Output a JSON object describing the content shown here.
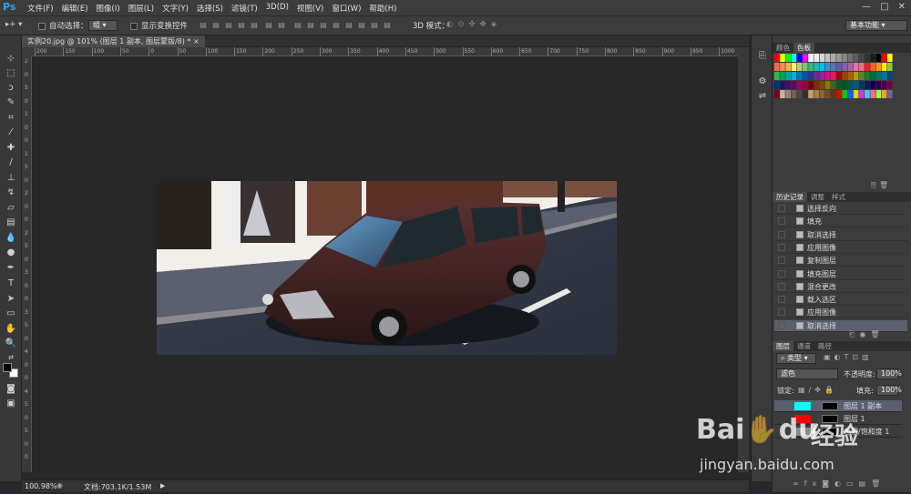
{
  "app": {
    "logo": "Ps",
    "menus": [
      "文件(F)",
      "编辑(E)",
      "图像(I)",
      "图层(L)",
      "文字(Y)",
      "选择(S)",
      "滤镜(T)",
      "3D(D)",
      "视图(V)",
      "窗口(W)",
      "帮助(H)"
    ],
    "window_controls": [
      "—",
      "□",
      "✕"
    ]
  },
  "options": {
    "auto_select_label": "自动选择：",
    "auto_select_value": "组",
    "show_transform_label": "显示变换控件",
    "mode3d_label": "3D 模式：",
    "workspace": "基本功能"
  },
  "document": {
    "tab_title": "实例20.jpg @ 101% (图层 1 副本, 图层蒙版/8) *",
    "close": "×"
  },
  "rulers": {
    "h": [
      "200",
      "150",
      "100",
      "50",
      "0",
      "50",
      "100",
      "150",
      "200",
      "250",
      "300",
      "350",
      "400",
      "450",
      "500",
      "550",
      "600",
      "650",
      "700",
      "750",
      "800",
      "850",
      "900",
      "950",
      "1000"
    ],
    "v": [
      "2",
      "0",
      "5",
      "0",
      "1",
      "0",
      "0",
      "1",
      "5",
      "0",
      "2",
      "0",
      "0",
      "2",
      "5",
      "0",
      "3",
      "0",
      "0",
      "3",
      "5",
      "0",
      "4",
      "0",
      "0",
      "4",
      "5",
      "0",
      "5",
      "0",
      "0"
    ]
  },
  "status": {
    "zoom": "100.98%",
    "doc": "文档:703.1K/1.53M"
  },
  "swatches": {
    "tabs": [
      "颜色",
      "色板"
    ],
    "active": 1
  },
  "history": {
    "tabs": [
      "历史记录",
      "调整",
      "样式"
    ],
    "items": [
      "选择反向",
      "填充",
      "取消选择",
      "应用图像",
      "复制图层",
      "填充图层",
      "混合更改",
      "载入选区",
      "应用图像",
      "取消选择"
    ]
  },
  "layers": {
    "tabs": [
      "图层",
      "通道",
      "路径"
    ],
    "filter": "类型",
    "blend": "滤色",
    "opacity_label": "不透明度:",
    "opacity": "100%",
    "lock_label": "锁定:",
    "fill_label": "填充:",
    "fill": "100%",
    "rows": [
      {
        "name": "图层 1 副本",
        "color": "#00ffff"
      },
      {
        "name": "图层 1",
        "color": "#ff0000"
      },
      {
        "name": "色相/饱和度 1",
        "color": "#888888"
      }
    ]
  },
  "watermark": {
    "brand": "Bai",
    "brand2": "du",
    "brand_cn": "经验",
    "url": "jingyan.baidu.com"
  }
}
